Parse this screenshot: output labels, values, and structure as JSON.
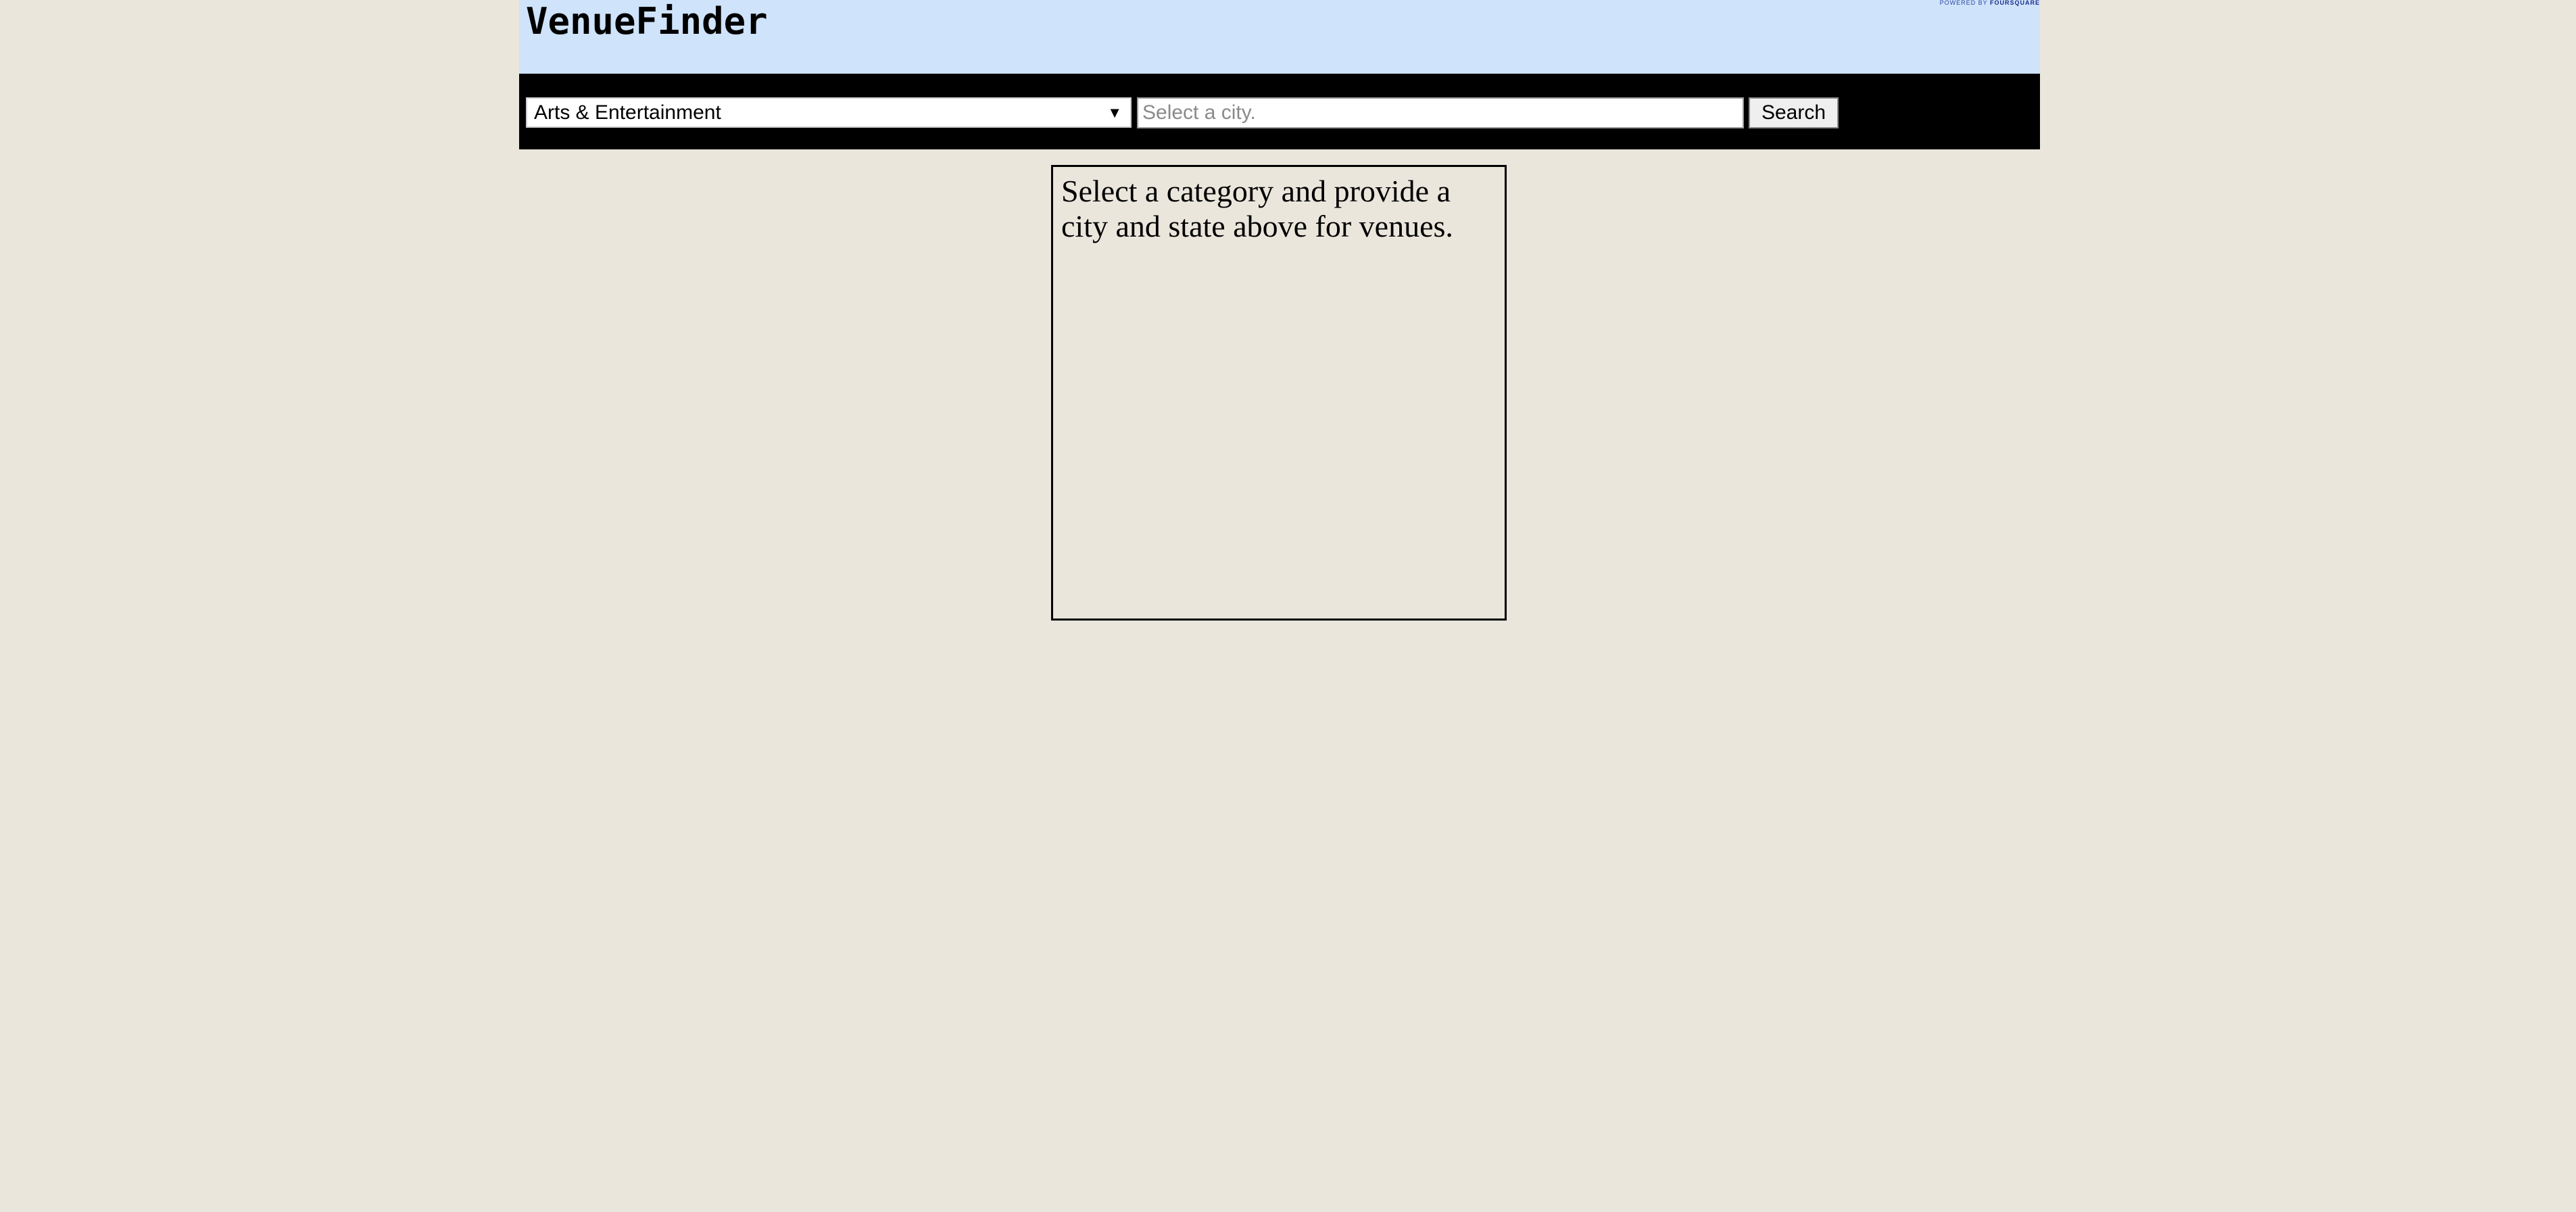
{
  "header": {
    "title": "VenueFinder",
    "powered_by_prefix": "Powered by ",
    "powered_by_brand": "Foursquare"
  },
  "toolbar": {
    "category_selected": "Arts & Entertainment",
    "city_placeholder": "Select a city.",
    "city_value": "",
    "search_label": "Search"
  },
  "results": {
    "message": "Select a category and provide a city and state above for venues."
  },
  "colors": {
    "page_background": "#eae6dc",
    "header_background": "#cfe3fb",
    "toolbar_background": "#000000"
  }
}
